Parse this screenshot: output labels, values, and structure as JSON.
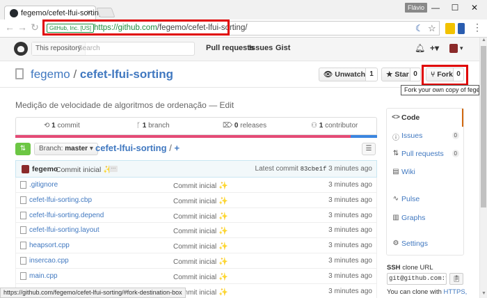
{
  "browser": {
    "tab_title": "fegemo/cefet-lfui-sorting",
    "tab_close": "×",
    "user_chip": "Flávio",
    "win_minimize": "—",
    "win_maximize": "☐",
    "win_close": "✕",
    "secure_label": "GitHub, Inc. [US]",
    "url_scheme": "https://",
    "url_host": "github.com",
    "url_path": "/fegemo/cefet-lfui-sorting/",
    "status_url": "https://github.com/fegemo/cefet-lfui-sorting/#fork-destination-box"
  },
  "gh_header": {
    "search_scope": "This repository",
    "search_placeholder": "Search",
    "nav": [
      "Pull requests",
      "Issues",
      "Gist"
    ],
    "plus": "+▾"
  },
  "repo": {
    "owner": "fegemo",
    "separator": "/",
    "name": "cefet-lfui-sorting",
    "watch_label": "Unwatch ▾",
    "watch_count": "1",
    "star_label": "Star",
    "star_count": "0",
    "fork_label": "Fork",
    "fork_count": "0",
    "fork_tooltip": "Fork your own copy of fegemo/cefet-lfui-sorting"
  },
  "description": {
    "text": "Medição de velocidade de algoritmos de ordenação",
    "dash": "—",
    "edit": "Edit"
  },
  "summary": {
    "commits_count": "1",
    "commits_label": "commit",
    "branches_count": "1",
    "branches_label": "branch",
    "releases_count": "0",
    "releases_label": "releases",
    "contributors_count": "1",
    "contributors_label": "contributor",
    "lang_colors": [
      "#e44b76",
      "#3b86e0"
    ]
  },
  "file_nav": {
    "branch_prefix": "Branch:",
    "branch_name": "master",
    "branch_caret": "▾",
    "breadcrumb": "cefet-lfui-sorting",
    "slash": "/",
    "plus": "+"
  },
  "commit_tease": {
    "author": "fegemo",
    "message": "Commit inicial",
    "ellipsis": "…",
    "latest_label": "Latest commit",
    "sha": "83cbe1f",
    "age": "3 minutes ago"
  },
  "files": [
    {
      "name": ".gitignore",
      "message": "Commit inicial",
      "age": "3 minutes ago"
    },
    {
      "name": "cefet-lfui-sorting.cbp",
      "message": "Commit inicial",
      "age": "3 minutes ago"
    },
    {
      "name": "cefet-lfui-sorting.depend",
      "message": "Commit inicial",
      "age": "3 minutes ago"
    },
    {
      "name": "cefet-lfui-sorting.layout",
      "message": "Commit inicial",
      "age": "3 minutes ago"
    },
    {
      "name": "heapsort.cpp",
      "message": "Commit inicial",
      "age": "3 minutes ago"
    },
    {
      "name": "insercao.cpp",
      "message": "Commit inicial",
      "age": "3 minutes ago"
    },
    {
      "name": "main.cpp",
      "message": "Commit inicial",
      "age": "3 minutes ago"
    },
    {
      "name": "",
      "message": "Commit inicial",
      "age": "3 minutes ago"
    }
  ],
  "sidebar": {
    "items": [
      {
        "label": "Code",
        "icon": "<>",
        "count": ""
      },
      {
        "label": "Issues",
        "icon": "ⓘ",
        "count": "0"
      },
      {
        "label": "Pull requests",
        "icon": "⇅",
        "count": "0"
      },
      {
        "label": "Wiki",
        "icon": "▤",
        "count": ""
      },
      {
        "label": "Pulse",
        "icon": "∿",
        "count": ""
      },
      {
        "label": "Graphs",
        "icon": "▥",
        "count": ""
      },
      {
        "label": "Settings",
        "icon": "⚙",
        "count": ""
      }
    ],
    "clone_proto": "SSH",
    "clone_label": "clone URL",
    "clone_value": "git@github.com:feg",
    "clone_note": "You can clone with",
    "clone_link": "HTTPS,"
  },
  "colors": {
    "accent_link": "#4078c0",
    "highlight_box": "#e00000",
    "compare_green": "#6cc644"
  }
}
